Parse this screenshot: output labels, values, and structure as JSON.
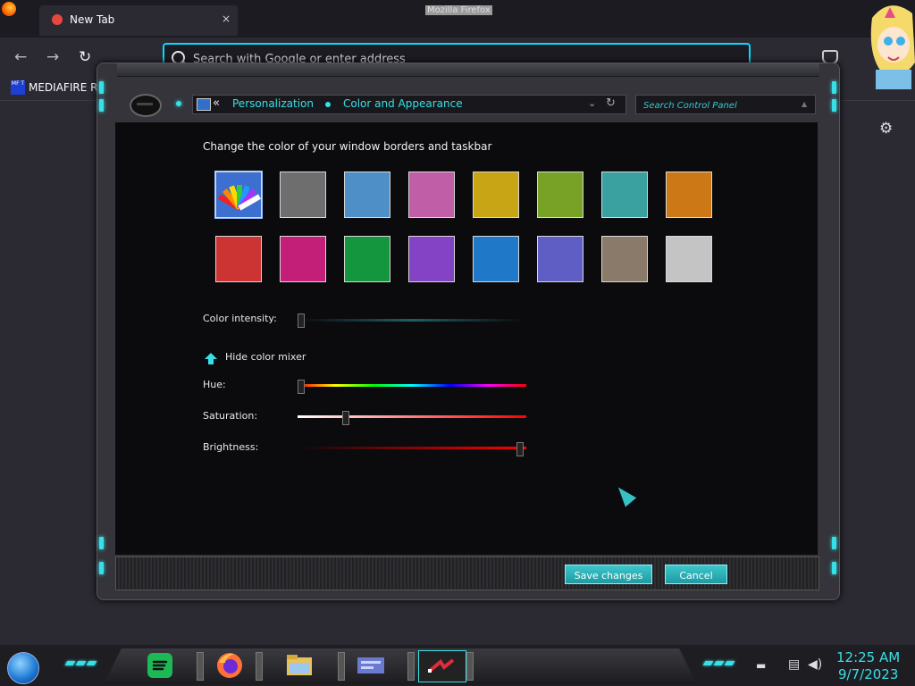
{
  "firefox": {
    "window_title": "Mozilla Firefox",
    "tab_title": "New Tab",
    "tab_close": "×",
    "url_placeholder": "Search with Google or enter address",
    "back": "←",
    "forward": "→",
    "reload": "↻",
    "bookmark_favicon": "MF T",
    "bookmark_label": "MEDIAFIRE RO",
    "settings_glyph": "⚙"
  },
  "control_panel": {
    "back_glyph": "«",
    "breadcrumbs": [
      "Personalization",
      "Color and Appearance"
    ],
    "dropdown_glyph": "⌄",
    "refresh_glyph": "↻",
    "search_placeholder": "Search Control Panel",
    "heading": "Change the color of your window borders and taskbar",
    "swatch_colors": [
      "#3c6fcf",
      "#6e6e6e",
      "#4e8fc8",
      "#c05fa8",
      "#c8a514",
      "#77a226",
      "#3ba0a0",
      "#cd7816",
      "#cc3434",
      "#c41f78",
      "#14963e",
      "#8442c4",
      "#1f78c8",
      "#5e5ec4",
      "#8a7a6a",
      "#c4c4c4"
    ],
    "selected_swatch": 0,
    "intensity_label": "Color intensity:",
    "intensity_value": 0,
    "hide_mixer_label": "Hide color mixer",
    "hue_label": "Hue:",
    "hue_value": 0,
    "saturation_label": "Saturation:",
    "saturation_value": 0.2,
    "brightness_label": "Brightness:",
    "brightness_value": 0.98,
    "save_label": "Save changes",
    "cancel_label": "Cancel",
    "accent_color": "#37e0e6"
  },
  "taskbar": {
    "apps": [
      "spotify-icon",
      "firefox-icon",
      "file-explorer-icon",
      "control-panel-icon",
      "media-icon"
    ],
    "time": "12:25 AM",
    "date": "9/7/2023"
  }
}
